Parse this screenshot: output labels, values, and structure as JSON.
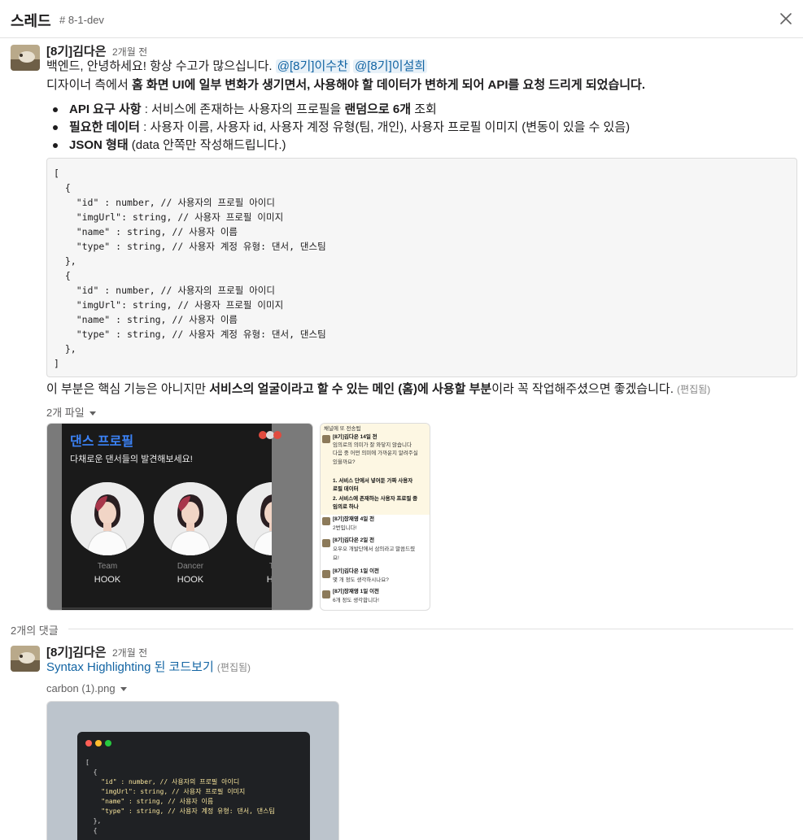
{
  "header": {
    "title": "스레드",
    "channel": "# 8-1-dev"
  },
  "message": {
    "author": "[8기]김다은",
    "time": "2개월 전",
    "greeting": "백엔드, 안녕하세요! 항상 수고가 많으십니다.",
    "mentions": [
      "@[8기]이수찬",
      "@[8기]이설희"
    ],
    "line2_prefix": "디자이너 측에서 ",
    "line2_bold": "홈 화면 UI에 일부 변화가 생기면서, 사용해야 할 데이터가 변하게 되어 API를 요청 드리게 되었습니다.",
    "bullets": [
      {
        "bold": "API 요구 사항",
        "text1": " : 서비스에 존재하는 사용자의 프로필을 ",
        "bold2": "랜덤으로 6개",
        "text2": " 조회"
      },
      {
        "bold": "필요한 데이터",
        "text1": " : 사용자 이름, 사용자 id, 사용자 계정 유형(팀, 개인), 사용자 프로필 이미지 (변동이 있을 수 있음)",
        "bold2": "",
        "text2": ""
      },
      {
        "bold": "JSON 형태",
        "text1": "  (data 안쪽만 작성해드립니다.)",
        "bold2": "",
        "text2": ""
      }
    ],
    "code": "[\n  {\n    \"id\" : number, // 사용자의 프로필 아이디\n    \"imgUrl\": string, // 사용자 프로필 이미지\n    \"name\" : string, // 사용자 이름\n    \"type\" : string, // 사용자 계정 유형: 댄서, 댄스팀\n  },\n  {\n    \"id\" : number, // 사용자의 프로필 아이디\n    \"imgUrl\": string, // 사용자 프로필 이미지\n    \"name\" : string, // 사용자 이름\n    \"type\" : string, // 사용자 계정 유형: 댄서, 댄스팀\n  },\n]",
    "closing_prefix": "이 부분은 핵심 기능은 아니지만 ",
    "closing_bold": "서비스의 얼굴이라고 할 수 있는 메인 (홈)에 사용할 부분",
    "closing_suffix": "이라 꼭 작업해주셨으면 좋겠습니다.",
    "edited": "(편집됨)",
    "files_label": "2개 파일",
    "preview1": {
      "title": "댄스 프로필",
      "subtitle": "다채로운 댄서들의 발견해보세요!",
      "cards": [
        {
          "role": "Team",
          "name": "HOOK"
        },
        {
          "role": "Dancer",
          "name": "HOOK"
        },
        {
          "role": "Te",
          "name": "HO"
        }
      ]
    },
    "preview2": {
      "lines": [
        "채널에 또 전송됨",
        "[8기]김다은  14일 전",
        "임의로의 의미가 잘 와닿지 않습니다",
        "다음 중 어떤 의미에 가까운지 알려주실",
        "있을까요?",
        "1.  서비스 단에서 넣어둔 가짜 사용자",
        "     로필 데이터",
        "2.  서비스에 존재하는 사용자 프로필 중",
        "     임의로 하나",
        "[8기]장재영  4일 전",
        "2번입니다!",
        "[8기]김다은  2일 전",
        "오우오 개발단에서 삼의라고 말씀드렸",
        "요!",
        "[8기]김다은  1일 이전",
        "몇 개 정도 생각하시나요?",
        "[8기]장재영  1일 이전",
        "6개 정도 생각합니다!"
      ]
    }
  },
  "replies": {
    "count_label": "2개의 댓글",
    "items": [
      {
        "author": "[8기]김다은",
        "time": "2개월 전",
        "link_text": "Syntax Highlighting 된 코드보기",
        "edited": "(편집됨)",
        "file_label": "carbon (1).png",
        "code_preview": [
          "[",
          "  {",
          "    \"id\" : number, // 사용자의 프로필 아이디",
          "    \"imgUrl\": string, // 사용자 프로필 이미지",
          "    \"name\" : string, // 사용자 이름",
          "    \"type\" : string, // 사용자 계정 유형: 댄서, 댄스팀",
          "  },",
          "  {"
        ]
      }
    ]
  },
  "colors": {
    "link": "#1264a3",
    "mention_bg": "#e8f1f8",
    "brand_blue": "#3b82f6"
  }
}
